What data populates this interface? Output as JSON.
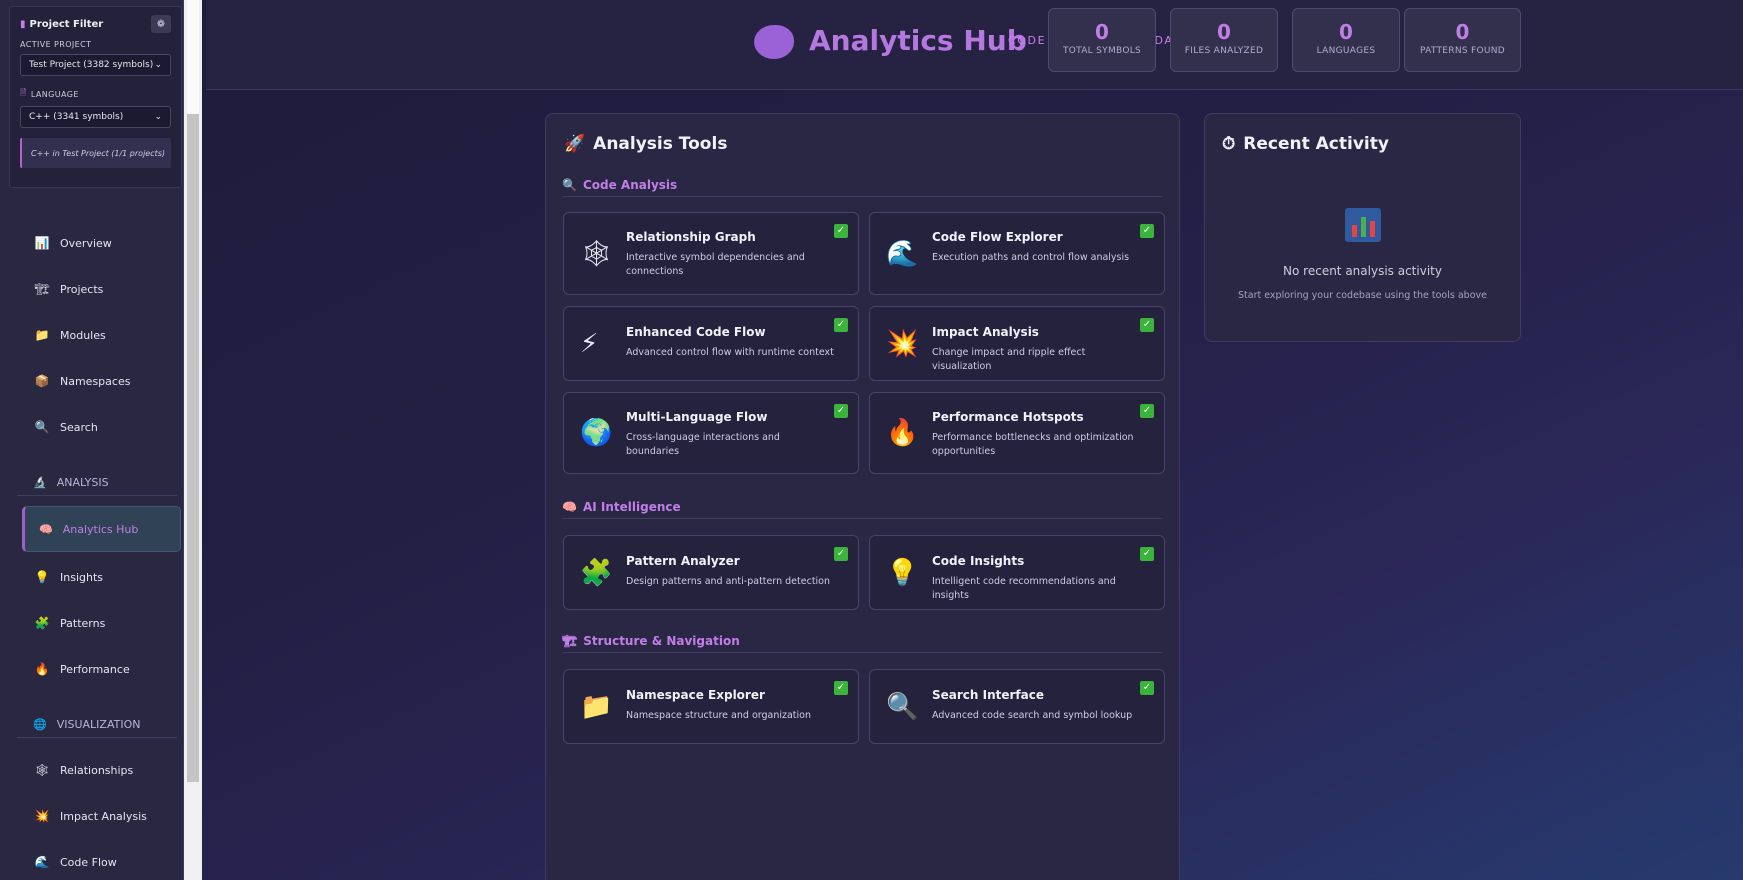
{
  "sidebar": {
    "filter": {
      "title": "Project Filter",
      "active_project_label": "ACTIVE PROJECT",
      "active_project_value": "Test Project (3382 symbols)",
      "language_label": "LANGUAGE",
      "language_value": "C++ (3341 symbols)",
      "note": "C++ in Test Project (1/1 projects)"
    },
    "items": [
      {
        "label": "Overview",
        "icon": "bar-chart-icon"
      },
      {
        "label": "Projects",
        "icon": "construction-icon"
      },
      {
        "label": "Modules",
        "icon": "folder-icon"
      },
      {
        "label": "Namespaces",
        "icon": "package-icon"
      },
      {
        "label": "Search",
        "icon": "magnifier-icon"
      }
    ],
    "section_analysis": "ANALYSIS",
    "active_item": "Analytics Hub",
    "analysis_items": [
      {
        "label": "Insights",
        "icon": "bulb-icon"
      },
      {
        "label": "Patterns",
        "icon": "puzzle-icon"
      },
      {
        "label": "Performance",
        "icon": "fire-icon"
      }
    ],
    "section_visualization": "VISUALIZATION",
    "viz_items": [
      {
        "label": "Relationships",
        "icon": "web-icon"
      },
      {
        "label": "Impact Analysis",
        "icon": "explosion-icon"
      },
      {
        "label": "Code Flow",
        "icon": "wave-icon"
      }
    ]
  },
  "header": {
    "title": "Analytics Hub",
    "subtitle": "CODE INTELLIGENCE DASHBOARD",
    "stats": [
      {
        "value": "0",
        "label": "TOTAL SYMBOLS"
      },
      {
        "value": "0",
        "label": "FILES ANALYZED"
      },
      {
        "value": "0",
        "label": "LANGUAGES"
      },
      {
        "value": "0",
        "label": "PATTERNS FOUND"
      }
    ]
  },
  "tools": {
    "title": "Analysis Tools",
    "sections": [
      {
        "title": "Code Analysis"
      },
      {
        "title": "AI Intelligence"
      },
      {
        "title": "Structure & Navigation"
      }
    ],
    "cards": [
      {
        "title": "Relationship Graph",
        "desc": "Interactive symbol dependencies and connections",
        "icon": "spider-web-icon"
      },
      {
        "title": "Code Flow Explorer",
        "desc": "Execution paths and control flow analysis",
        "icon": "wave-icon"
      },
      {
        "title": "Enhanced Code Flow",
        "desc": "Advanced control flow with runtime context",
        "icon": "lightning-icon"
      },
      {
        "title": "Impact Analysis",
        "desc": "Change impact and ripple effect visualization",
        "icon": "explosion-icon"
      },
      {
        "title": "Multi-Language Flow",
        "desc": "Cross-language interactions and boundaries",
        "icon": "globe-icon"
      },
      {
        "title": "Performance Hotspots",
        "desc": "Performance bottlenecks and optimization opportunities",
        "icon": "fire-icon"
      },
      {
        "title": "Pattern Analyzer",
        "desc": "Design patterns and anti-pattern detection",
        "icon": "puzzle-icon"
      },
      {
        "title": "Code Insights",
        "desc": "Intelligent code recommendations and insights",
        "icon": "bulb-icon"
      },
      {
        "title": "Namespace Explorer",
        "desc": "Namespace structure and organization",
        "icon": "folder-icon"
      },
      {
        "title": "Search Interface",
        "desc": "Advanced code search and symbol lookup",
        "icon": "magnifier-icon"
      }
    ]
  },
  "activity": {
    "title": "Recent Activity",
    "empty_title": "No recent analysis activity",
    "empty_desc": "Start exploring your codebase using the tools above"
  }
}
